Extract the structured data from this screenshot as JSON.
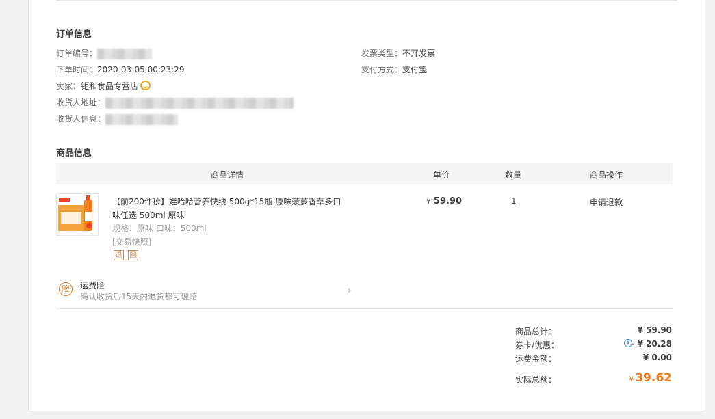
{
  "order_info": {
    "title": "订单信息",
    "order_no_label": "订单编号：",
    "order_time_label": "下单时间：",
    "order_time": "2020-03-05 00:23:29",
    "seller_label": "卖家：",
    "seller": "钜和食品专营店",
    "address_label": "收货人地址：",
    "receiver_label": "收货人信息：",
    "invoice_type_label": "发票类型：",
    "invoice_type": "不开发票",
    "payment_label": "支付方式：",
    "payment": "支付宝"
  },
  "goods_info": {
    "title": "商品信息",
    "columns": [
      "商品详情",
      "单价",
      "数量",
      "商品操作"
    ],
    "item": {
      "name": "【前200件秒】娃哈哈营养快线 500g*15瓶 原味菠萝香草多口味任选 500ml 原味",
      "spec": "规格：原味  口味：500ml",
      "snapshot": "[交易快照]",
      "tag1": "退",
      "tag2": "圖",
      "price": "59.90",
      "price_symbol": "¥",
      "quantity": "1",
      "action": "申请退款"
    },
    "insurance": {
      "icon_text": "险",
      "title": "运费险",
      "subtitle": "确认收货后15天内退货都可理赔"
    }
  },
  "summary": {
    "goods_total_label": "商品总计：",
    "goods_total": "¥ 59.90",
    "coupon_label": "券卡/优惠：",
    "coupon": "- ¥ 20.28",
    "shipping_label": "运费金额：",
    "shipping": "¥  0.00",
    "actual_label": "实际总额：",
    "actual_symbol": "¥",
    "actual": "39.62"
  },
  "colors": {
    "accent": "#f27a1a",
    "info": "#3b8cd8",
    "wangwang": "#f3a923"
  },
  "icons": [
    "wangwang-chat-icon",
    "insurance-icon",
    "chevron-right-icon",
    "info-icon"
  ]
}
